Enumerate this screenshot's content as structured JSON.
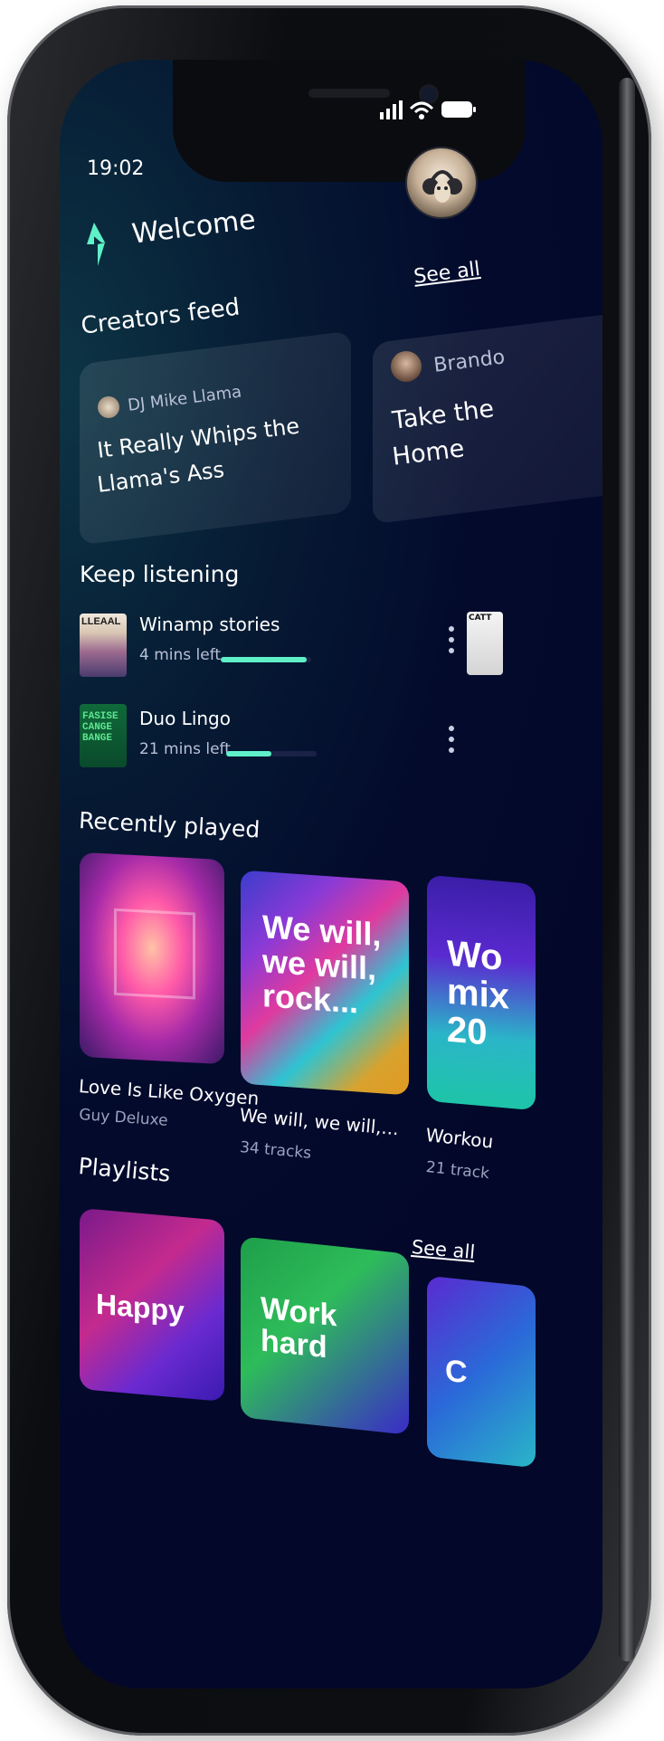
{
  "status_bar": {
    "time": "19:02"
  },
  "header": {
    "title": "Welcome",
    "see_all": "See all"
  },
  "creators_feed": {
    "heading": "Creators feed",
    "cards": [
      {
        "author": "DJ Mike Llama",
        "title_line1": "It Really Whips the",
        "title_line2": "Llama's Ass"
      },
      {
        "author": "Brando",
        "title_line1": "Take the",
        "title_line2": "Home"
      }
    ]
  },
  "keep_listening": {
    "heading": "Keep listening",
    "items": [
      {
        "art_text": "LLEAAL",
        "title": "Winamp stories",
        "time_left": "4 mins left",
        "progress": 0.95,
        "bar_color": "#5ff0c8"
      },
      {
        "art_text_1": "FASISE",
        "art_text_2": "CANGE",
        "art_text_3": "BANGE",
        "title": "Duo Lingo",
        "time_left": "21 mins left",
        "progress": 0.5,
        "bar_color": "#5ff0c8"
      }
    ],
    "side_art_text": "CATT"
  },
  "recently_played": {
    "heading": "Recently played",
    "items": [
      {
        "title": "Love Is Like Oxygen",
        "subtitle": "Guy Deluxe"
      },
      {
        "cover_line1": "We will,",
        "cover_line2": "we will,",
        "cover_line3": "rock...",
        "title": "We will, we will,...",
        "subtitle": "34 tracks"
      },
      {
        "cover_line1": "Wo",
        "cover_line2": "mix",
        "cover_line3": "20",
        "title": "Workou",
        "subtitle": "21 track"
      }
    ]
  },
  "playlists": {
    "heading": "Playlists",
    "see_all": "See all",
    "items": [
      {
        "cover_text": "Happy"
      },
      {
        "cover_line1": "Work",
        "cover_line2": "hard"
      },
      {
        "cover_text": "C"
      }
    ]
  },
  "colors": {
    "accent": "#5ff0c8",
    "background": "#030a2c"
  }
}
